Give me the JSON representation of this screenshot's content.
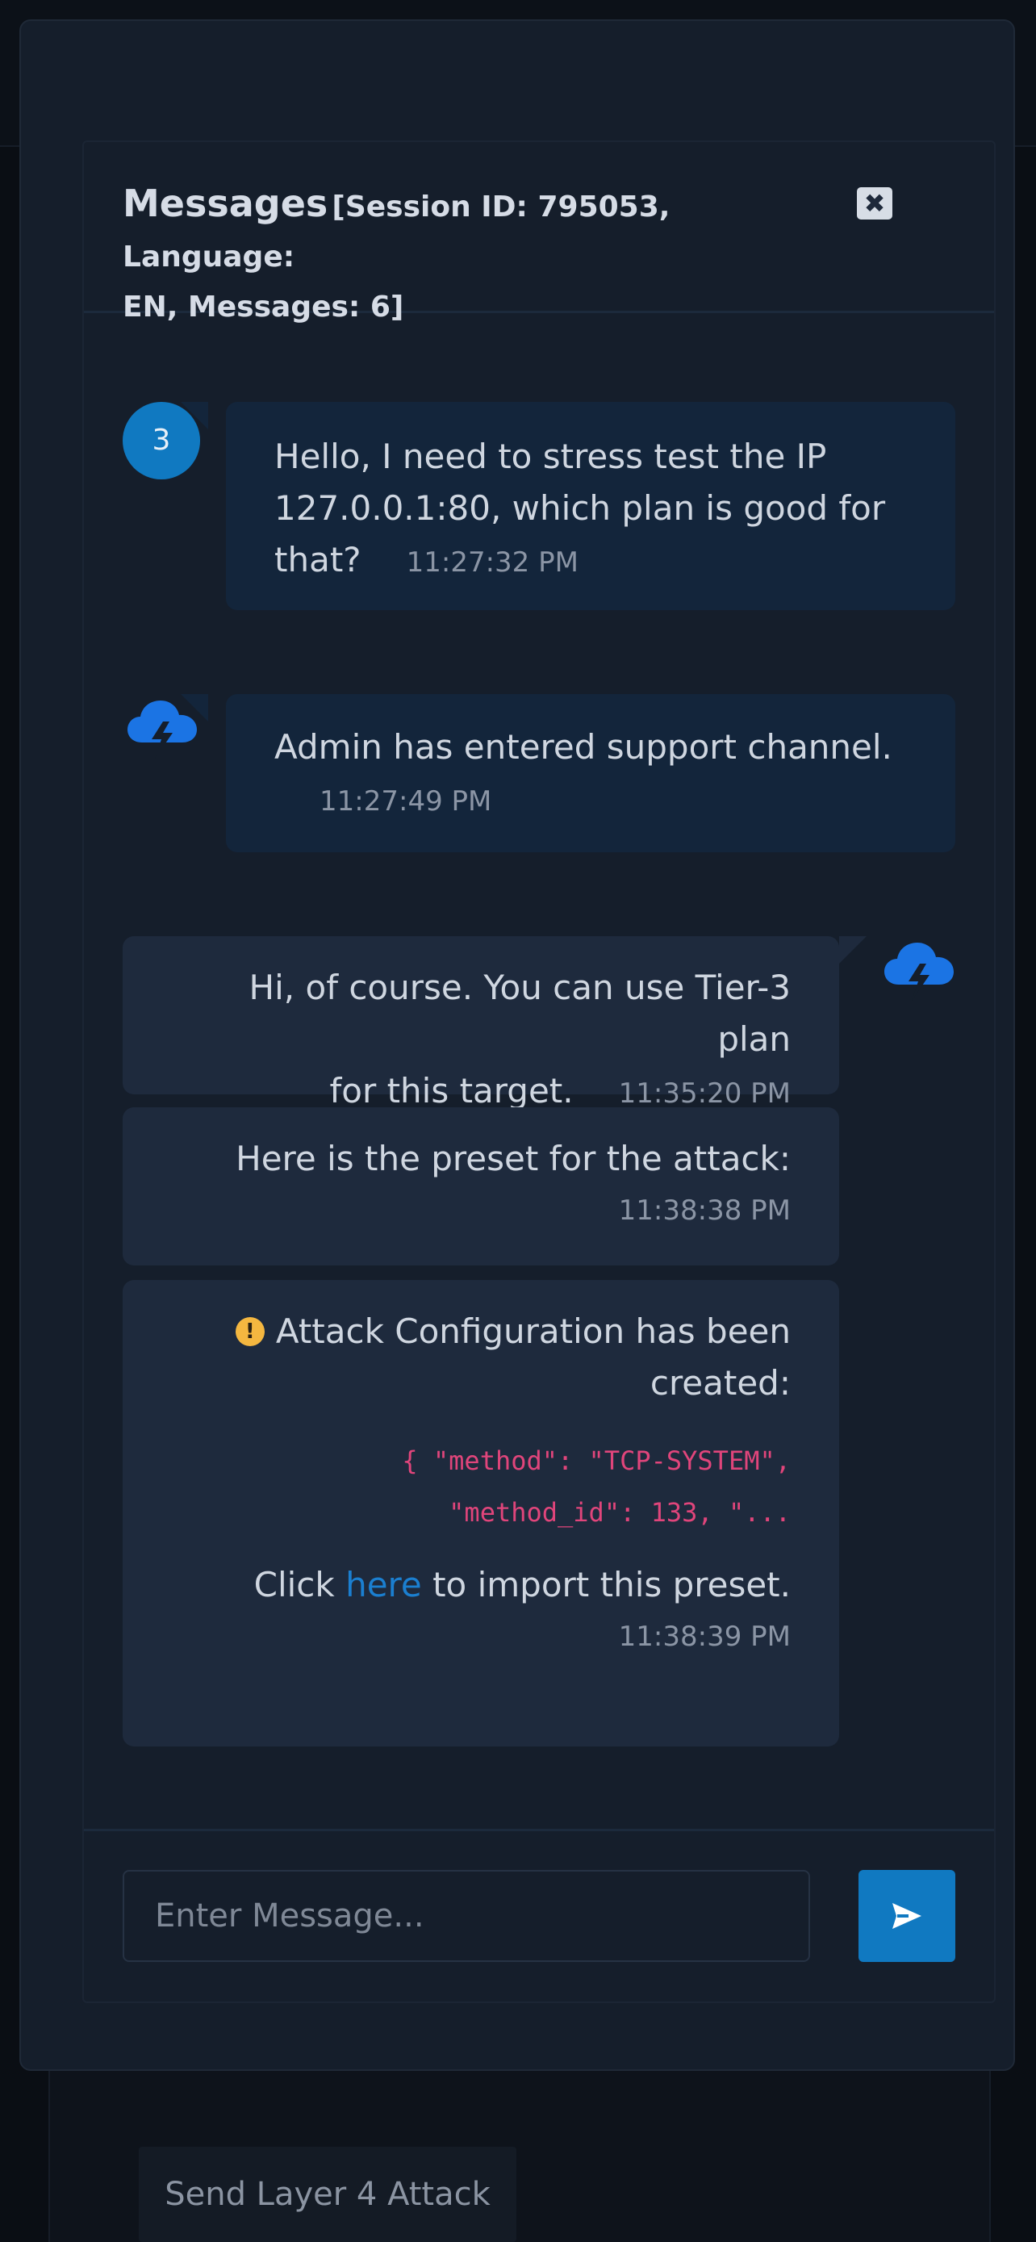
{
  "background": {
    "action_button_label": "Send Layer 4 Attack"
  },
  "chat": {
    "title": "Messages",
    "session_meta_line1": "[Session ID: 795053, Language:",
    "session_meta_line2": "EN, Messages: 6]",
    "close_icon": "close-icon",
    "messages": [
      {
        "sender_badge": "3",
        "text_line1": "Hello, I need to stress test the IP",
        "text_line2": "127.0.0.1:80, which plan is good for",
        "text_line3": "that?",
        "time": "11:27:32 PM"
      },
      {
        "sender_icon": "lightning-cloud-icon",
        "text": "Admin has entered support channel.",
        "time": "11:27:49 PM"
      },
      {
        "sender_icon": "lightning-cloud-icon",
        "text_line1": "Hi, of course. You can use Tier-3 plan",
        "text_line2": "for this target.",
        "time": "11:35:20 PM"
      },
      {
        "text": "Here is the preset for the attack:",
        "time": "11:38:38 PM"
      },
      {
        "warning_icon": "exclamation-circle-icon",
        "text_line1": "Attack Configuration has been",
        "text_line2": "created:",
        "code_line1": "{ \"method\": \"TCP-SYSTEM\",",
        "code_line2": "\"method_id\": 133, \"...",
        "click_prefix": "Click ",
        "link_text": "here",
        "click_suffix": " to import this preset.",
        "time": "11:38:39 PM"
      }
    ],
    "input_placeholder": "Enter Message...",
    "send_icon": "send-icon"
  },
  "colors": {
    "accent": "#1079c1",
    "link": "#1b7fd0",
    "code": "#e0457b",
    "warning": "#f4b740"
  }
}
